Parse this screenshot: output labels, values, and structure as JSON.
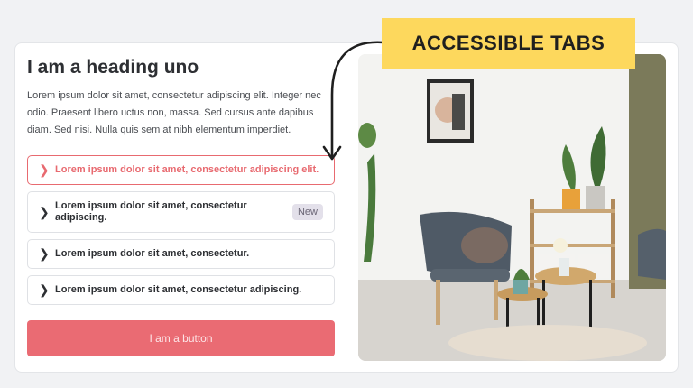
{
  "banner": {
    "text": "ACCESSIBLE TABS"
  },
  "panel": {
    "heading": "I am a heading uno",
    "paragraph": "Lorem ipsum dolor sit amet, consectetur adipiscing elit. Integer nec odio. Praesent libero uctus non, massa. Sed cursus ante dapibus diam. Sed nisi. Nulla quis sem at nibh elementum imperdiet.",
    "tabs": [
      {
        "label": "Lorem ipsum dolor sit amet, consectetur adipiscing elit.",
        "badge": ""
      },
      {
        "label": "Lorem ipsum dolor sit amet, consectetur adipiscing.",
        "badge": "New"
      },
      {
        "label": "Lorem ipsum dolor sit amet, consectetur.",
        "badge": ""
      },
      {
        "label": "Lorem ipsum dolor sit amet, consectetur adipiscing.",
        "badge": ""
      }
    ],
    "button_label": "I am a button"
  },
  "colors": {
    "accent": "#ea6b73",
    "banner": "#fdd85d"
  },
  "icons": {
    "tab_chevron": "chevron-right-icon",
    "arrow": "curved-arrow-icon"
  }
}
